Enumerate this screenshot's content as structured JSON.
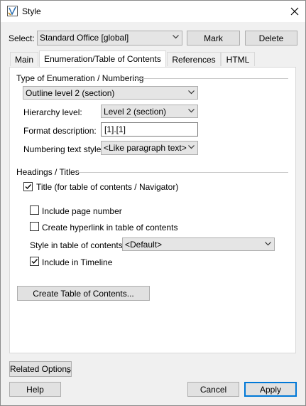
{
  "window": {
    "title": "Style",
    "close_icon": "close-icon",
    "app_icon": "style-app-icon"
  },
  "select_row": {
    "label": "Select:",
    "value": "Standard Office [global]",
    "mark_label": "Mark",
    "delete_label": "Delete"
  },
  "tabs": [
    {
      "label": "Main"
    },
    {
      "label": "Enumeration/Table of Contents"
    },
    {
      "label": "References"
    },
    {
      "label": "HTML"
    }
  ],
  "enumeration": {
    "group_title": "Type of Enumeration / Numbering",
    "type_value": "Outline level 2 (section)",
    "hierarchy_label": "Hierarchy level:",
    "hierarchy_value": "Level 2 (section)",
    "format_label": "Format description:",
    "format_value": "[1].[1]",
    "numbering_style_label": "Numbering text style:",
    "numbering_style_value": "<Like paragraph text>"
  },
  "headings": {
    "group_title": "Headings / Titles",
    "title_checkbox_label": "Title (for table of contents / Navigator)",
    "title_checked": true,
    "include_page_label": "Include page number",
    "include_page_checked": false,
    "hyperlink_label": "Create hyperlink in table of contents",
    "hyperlink_checked": false,
    "toc_style_label": "Style in table of contents:",
    "toc_style_value": "<Default>",
    "timeline_label": "Include in Timeline",
    "timeline_checked": true,
    "create_toc_label": "Create Table of Contents..."
  },
  "footer": {
    "related_options_label": "Related Options",
    "help_label": "Help",
    "cancel_label": "Cancel",
    "apply_label": "Apply"
  },
  "colors": {
    "accent": "#0078d7",
    "panel": "#ffffff",
    "dialog_bg": "#f0f0f0"
  }
}
